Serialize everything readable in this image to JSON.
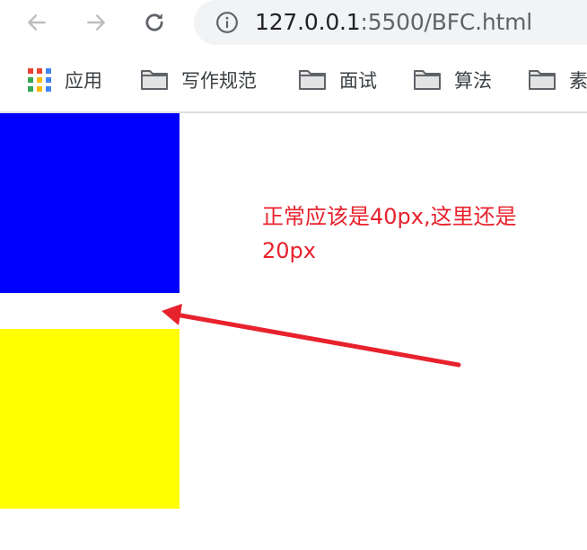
{
  "browser": {
    "url_host": "127.0.0.1",
    "url_rest": ":5500/BFC.html",
    "back_icon": "arrow-left-icon",
    "forward_icon": "arrow-right-icon",
    "reload_icon": "reload-icon",
    "info_icon": "info-icon"
  },
  "bookmarks": {
    "items": [
      {
        "label": "应用",
        "icon": "apps-grid-icon"
      },
      {
        "label": "写作规范",
        "icon": "folder-icon"
      },
      {
        "label": "面试",
        "icon": "folder-icon"
      },
      {
        "label": "算法",
        "icon": "folder-icon"
      },
      {
        "label": "素",
        "icon": "folder-icon"
      }
    ]
  },
  "page": {
    "annotation_line1": "正常应该是40px,这里还是",
    "annotation_line2": "20px",
    "annotation_color": "#e8222d",
    "box1_color": "#0000ff",
    "box2_color": "#ffff00"
  }
}
